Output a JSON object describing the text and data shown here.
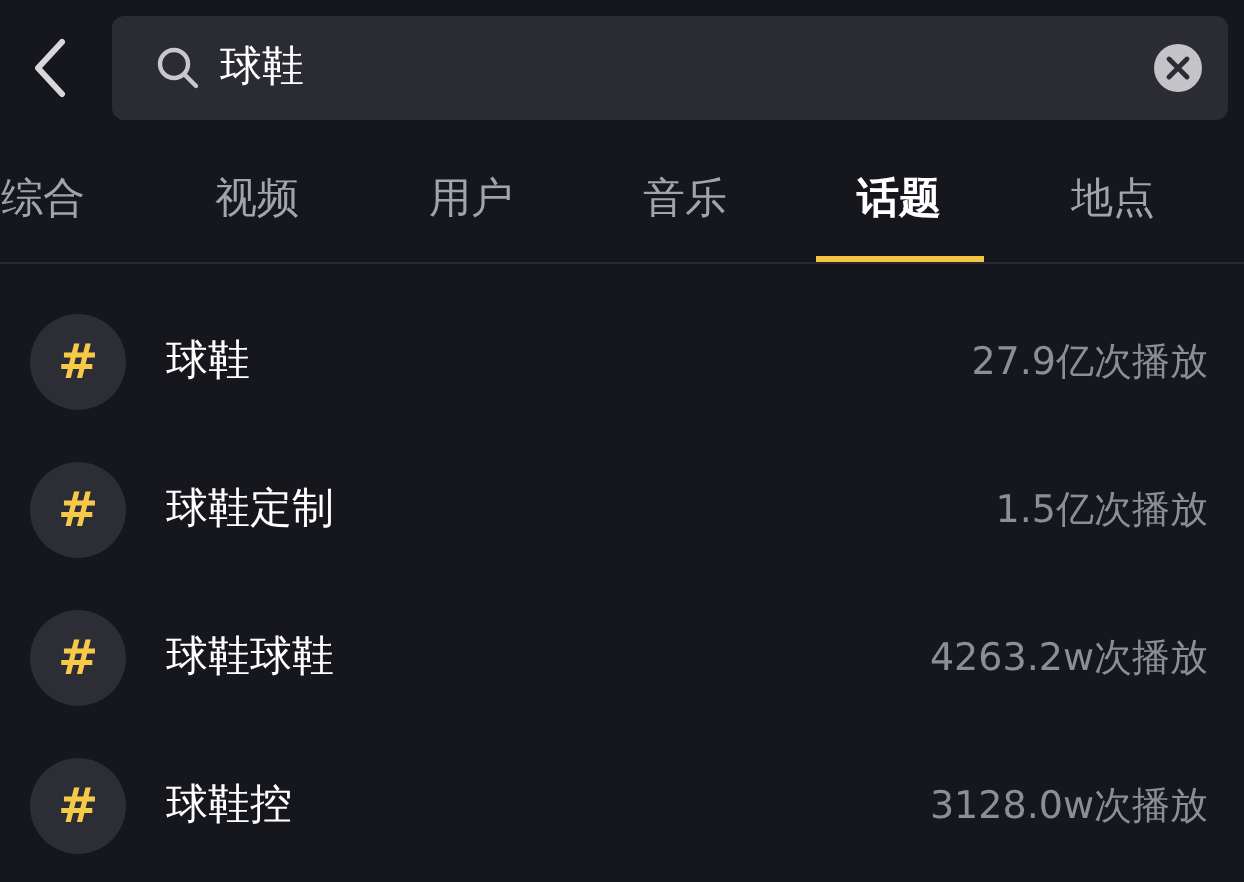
{
  "search": {
    "value": "球鞋"
  },
  "tabs": [
    {
      "label": "综合",
      "selected": false
    },
    {
      "label": "视频",
      "selected": false
    },
    {
      "label": "用户",
      "selected": false
    },
    {
      "label": "音乐",
      "selected": false
    },
    {
      "label": "话题",
      "selected": true
    },
    {
      "label": "地点",
      "selected": false
    }
  ],
  "topics": [
    {
      "icon": "#",
      "name": "球鞋",
      "plays": "27.9亿次播放"
    },
    {
      "icon": "#",
      "name": "球鞋定制",
      "plays": "1.5亿次播放"
    },
    {
      "icon": "#",
      "name": "球鞋球鞋",
      "plays": "4263.2w次播放"
    },
    {
      "icon": "#",
      "name": "球鞋控",
      "plays": "3128.0w次播放"
    }
  ]
}
